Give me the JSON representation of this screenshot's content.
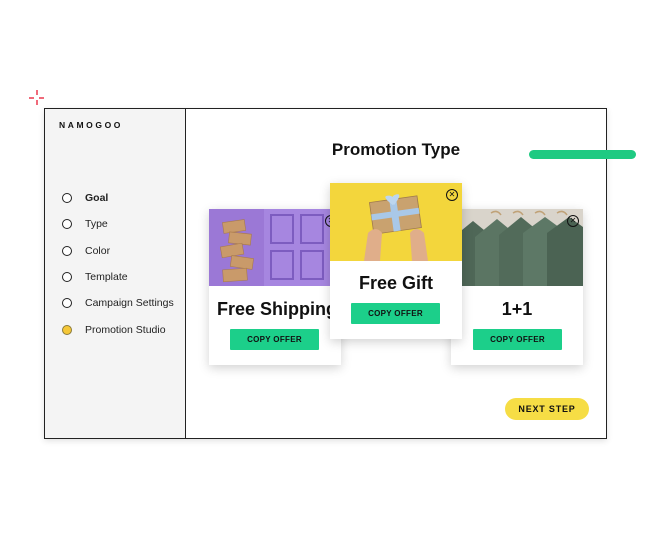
{
  "brand": {
    "logo_text": "NAMOGOO"
  },
  "sidebar": {
    "steps": [
      {
        "label": "Goal",
        "state": "active"
      },
      {
        "label": "Type",
        "state": "default"
      },
      {
        "label": "Color",
        "state": "default"
      },
      {
        "label": "Template",
        "state": "default"
      },
      {
        "label": "Campaign Settings",
        "state": "default"
      },
      {
        "label": "Promotion Studio",
        "state": "current"
      }
    ]
  },
  "main": {
    "title": "Promotion Type",
    "offers": [
      {
        "title": "Free Shipping",
        "button_label": "COPY OFFER",
        "image": "stacked-boxes-purple-door"
      },
      {
        "title": "Free Gift",
        "button_label": "COPY OFFER",
        "image": "hands-holding-gift-box"
      },
      {
        "title": "1+1",
        "button_label": "COPY OFFER",
        "image": "green-shirts-on-hangers"
      }
    ],
    "next_button_label": "NEXT STEP"
  },
  "colors": {
    "accent_green": "#1fca82",
    "accent_yellow": "#f6dd45",
    "sparkle": "#f06a7a"
  }
}
